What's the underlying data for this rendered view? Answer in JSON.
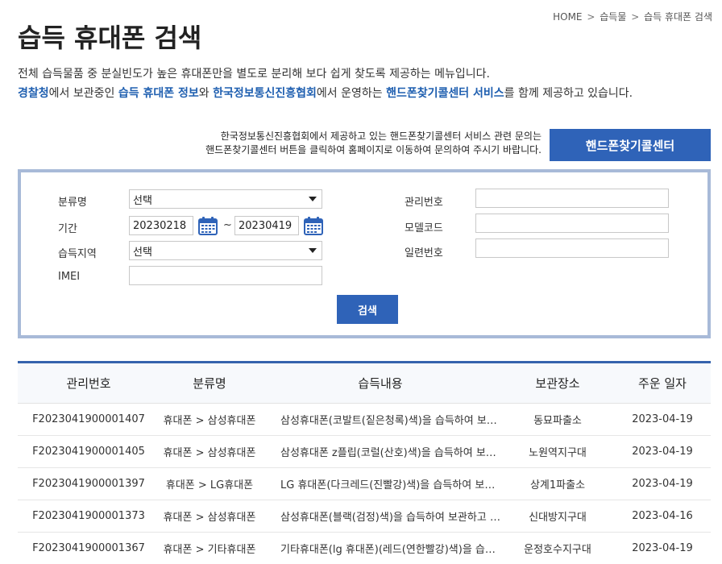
{
  "breadcrumb": {
    "items": [
      "HOME",
      "습득물",
      "습득 휴대폰 검색"
    ],
    "separator": ">"
  },
  "page_title": "습득 휴대폰 검색",
  "intro": {
    "line1": "전체 습득물품 중 분실빈도가 높은 휴대폰만을 별도로 분리해 보다 쉽게 찾도록 제공하는 메뉴입니다.",
    "line2": {
      "p1": "경찰청",
      "p2": "에서 보관중인 ",
      "p3": "습득 휴대폰 정보",
      "p4": "와 ",
      "p5": "한국정보통신진흥협회",
      "p6": "에서 운영하는 ",
      "p7": "핸드폰찾기콜센터 서비스",
      "p8": "를 함께 제공하고 있습니다."
    }
  },
  "notice": {
    "line1": "한국정보통신진흥협회에서 제공하고 있는 핸드폰찾기콜센터 서비스 관련 문의는",
    "line2": "핸드폰찾기콜센터 버튼을 클릭하여 홈페이지로 이동하여 문의하여 주시기 바랍니다."
  },
  "center_button_label": "핸드폰찾기콜센터",
  "search": {
    "category_label": "분류명",
    "category_value": "선택",
    "period_label": "기간",
    "period_from": "20230218",
    "period_to": "20230419",
    "period_separator": "~",
    "region_label": "습득지역",
    "region_value": "선택",
    "imei_label": "IMEI",
    "imei_value": "",
    "mgmt_no_label": "관리번호",
    "mgmt_no_value": "",
    "model_code_label": "모델코드",
    "model_code_value": "",
    "serial_label": "일련번호",
    "serial_value": "",
    "button_label": "검색"
  },
  "table": {
    "headers": [
      "관리번호",
      "분류명",
      "습득내용",
      "보관장소",
      "주운 일자"
    ],
    "rows": [
      {
        "id": "F2023041900001407",
        "category": "휴대폰 > 삼성휴대폰",
        "content": "삼성휴대폰(코발트(짙은청록)색)을 습득하여 보관하고 있습니다.",
        "place": "동묘파출소",
        "date": "2023-04-19"
      },
      {
        "id": "F2023041900001405",
        "category": "휴대폰 > 삼성휴대폰",
        "content": "삼성휴대폰 z플립(코럴(산호)색)을 습득하여 보관하고 있습니다.",
        "place": "노원역지구대",
        "date": "2023-04-19"
      },
      {
        "id": "F2023041900001397",
        "category": "휴대폰 > LG휴대폰",
        "content": "LG 휴대폰(다크레드(진빨강)색)을 습득하여 보관하고 있습니다.",
        "place": "상계1파출소",
        "date": "2023-04-19"
      },
      {
        "id": "F2023041900001373",
        "category": "휴대폰 > 삼성휴대폰",
        "content": "삼성휴대폰(블랙(검정)색)을 습득하여 보관하고 있습니다.",
        "place": "신대방지구대",
        "date": "2023-04-16"
      },
      {
        "id": "F2023041900001367",
        "category": "휴대폰 > 기타휴대폰",
        "content": "기타휴대폰(lg 휴대폰)(레드(연한빨강)색)을 습득하여 보관하고 있습니다.",
        "place": "운정호수지구대",
        "date": "2023-04-19"
      }
    ]
  },
  "colors": {
    "accent": "#2f63b8",
    "highlight_text": "#1f5fb0",
    "search_border": "#a8bad8"
  },
  "icons": {
    "calendar": "calendar-icon",
    "dropdown": "chevron-down-icon"
  }
}
